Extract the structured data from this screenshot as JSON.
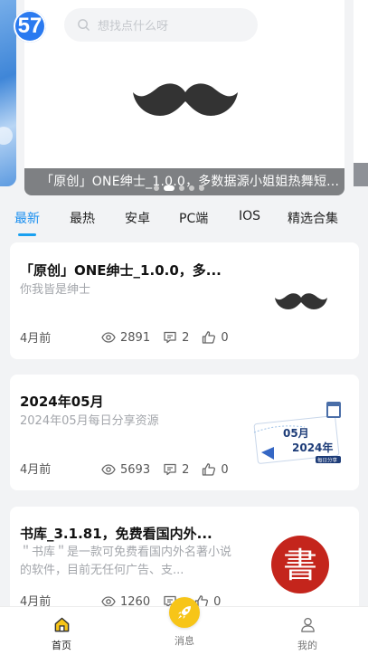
{
  "header": {
    "badge": "57",
    "search_placeholder": "想找点什么呀"
  },
  "carousel": {
    "caption": "「原创」ONE绅士_1.0.0，多数据源小姐姐热舞短...",
    "slide_count": 5,
    "active_index": 1
  },
  "tabs": [
    "最新",
    "最热",
    "安卓",
    "PC端",
    "IOS",
    "精选合集"
  ],
  "active_tab": 0,
  "posts": [
    {
      "title": "「原创」ONE绅士_1.0.0，多...",
      "desc": "你我皆是绅士",
      "time": "4月前",
      "views": "2891",
      "comments": "2",
      "likes": "0",
      "thumb": "mustache-icon"
    },
    {
      "title": "2024年05月",
      "desc": "2024年05月每日分享资源",
      "time": "4月前",
      "views": "5693",
      "comments": "2",
      "likes": "0",
      "thumb": "calendar-thumb",
      "thumb_text": {
        "month": "05月",
        "year": "2024年",
        "tag": "每日分享"
      }
    },
    {
      "title": "书库_3.1.81，免费看国内外...",
      "desc": "＂书库＂是一款可免费看国内外名著小说的软件，目前无任何广告、支...",
      "time": "4月前",
      "views": "1260",
      "comments": "",
      "likes": "0",
      "thumb": "book-logo",
      "thumb_text": "書"
    }
  ],
  "bottom_nav": [
    {
      "label": "首页",
      "icon": "home-icon"
    },
    {
      "label": "消息",
      "icon": "rocket-icon"
    },
    {
      "label": "我的",
      "icon": "user-icon"
    }
  ],
  "colors": {
    "accent": "#1a8ff0",
    "badge": "#2a7af0",
    "fab": "#f7c518",
    "seal_red": "#c4251c"
  }
}
